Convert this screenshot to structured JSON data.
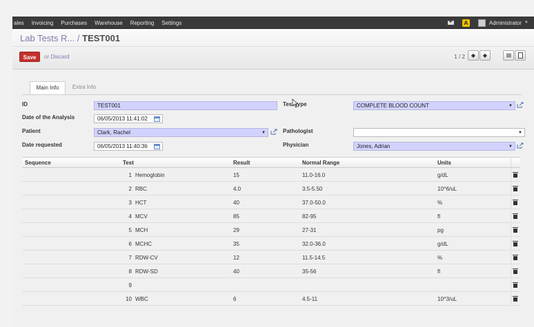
{
  "nav": {
    "menu": [
      "ales",
      "Invoicing",
      "Purchases",
      "Warehouse",
      "Reporting",
      "Settings"
    ],
    "warning_badge": "A",
    "user": "Administrator"
  },
  "header": {
    "breadcrumb_parent": "Lab Tests R...",
    "breadcrumb_sep": "/",
    "breadcrumb_current": "TEST001",
    "save_label": "Save",
    "or_label": "or",
    "discard_label": "Discard",
    "pager": "1 / 2",
    "prev_icon": "arrow-left-icon",
    "next_icon": "arrow-right-icon"
  },
  "tabs": [
    {
      "label": "Main Info",
      "active": true
    },
    {
      "label": "Extra Info",
      "active": false
    }
  ],
  "form": {
    "id_label": "ID",
    "id_value": "TEST001",
    "date_analysis_label": "Date of the Analysis",
    "date_analysis_value": "06/05/2013 11:41:02",
    "patient_label": "Patient",
    "patient_value": "Clark, Rachel",
    "date_requested_label": "Date requested",
    "date_requested_value": "06/05/2013 11:40:36",
    "test_type_label": "Test type",
    "test_type_value": "COMPLETE BLOOD COUNT",
    "pathologist_label": "Pathologist",
    "pathologist_value": "",
    "physician_label": "Physician",
    "physician_value": "Jones, Adrian"
  },
  "table": {
    "headers": [
      "Sequence",
      "Test",
      "Result",
      "Normal Range",
      "Units"
    ],
    "rows": [
      {
        "seq": "1",
        "test": "Hemoglobin",
        "result": "15",
        "range": "11.0-16.0",
        "units": "g/dL"
      },
      {
        "seq": "2",
        "test": "RBC",
        "result": "4.0",
        "range": "3.5-5.50",
        "units": "10^6/uL"
      },
      {
        "seq": "3",
        "test": "HCT",
        "result": "40",
        "range": "37.0-50.0",
        "units": "%"
      },
      {
        "seq": "4",
        "test": "MCV",
        "result": "85",
        "range": "82-95",
        "units": "fl"
      },
      {
        "seq": "5",
        "test": "MCH",
        "result": "29",
        "range": "27-31",
        "units": "pg"
      },
      {
        "seq": "6",
        "test": "MCHC",
        "result": "35",
        "range": "32.0-36.0",
        "units": "g/dL"
      },
      {
        "seq": "7",
        "test": "RDW-CV",
        "result": "12",
        "range": "11.5-14.5",
        "units": "%"
      },
      {
        "seq": "8",
        "test": "RDW-SD",
        "result": "40",
        "range": "35-56",
        "units": "fl"
      },
      {
        "seq": "9",
        "test": "",
        "result": "",
        "range": "",
        "units": ""
      },
      {
        "seq": "10",
        "test": "WBC",
        "result": "6",
        "range": "4.5-11",
        "units": "10^3/uL"
      }
    ]
  },
  "colors": {
    "required_bg": "#d2d2ff",
    "save_button": "#c2312f",
    "link": "#7c7bad",
    "topbar": "#3a3a3a"
  }
}
